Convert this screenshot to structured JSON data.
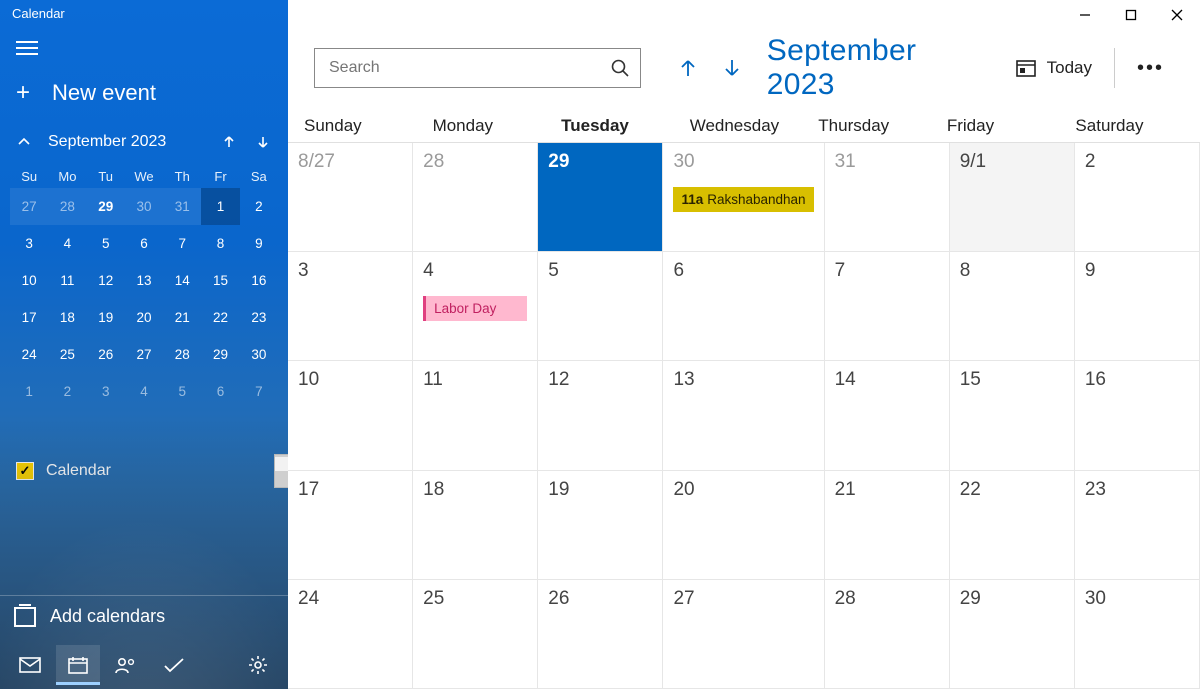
{
  "window": {
    "title": "Calendar"
  },
  "sidebar": {
    "new_event_label": "New event",
    "mini": {
      "title": "September 2023",
      "dow": [
        "Su",
        "Mo",
        "Tu",
        "We",
        "Th",
        "Fr",
        "Sa"
      ],
      "rows": [
        [
          {
            "d": "27",
            "other": true,
            "rng": true
          },
          {
            "d": "28",
            "other": true,
            "rng": true
          },
          {
            "d": "29",
            "sel": true,
            "rng": true
          },
          {
            "d": "30",
            "other": true,
            "rng": true
          },
          {
            "d": "31",
            "other": true,
            "rng": true
          },
          {
            "d": "1",
            "fri1": true
          },
          {
            "d": "2"
          }
        ],
        [
          {
            "d": "3"
          },
          {
            "d": "4"
          },
          {
            "d": "5"
          },
          {
            "d": "6"
          },
          {
            "d": "7"
          },
          {
            "d": "8"
          },
          {
            "d": "9"
          }
        ],
        [
          {
            "d": "10"
          },
          {
            "d": "11"
          },
          {
            "d": "12"
          },
          {
            "d": "13"
          },
          {
            "d": "14"
          },
          {
            "d": "15"
          },
          {
            "d": "16"
          }
        ],
        [
          {
            "d": "17"
          },
          {
            "d": "18"
          },
          {
            "d": "19"
          },
          {
            "d": "20"
          },
          {
            "d": "21"
          },
          {
            "d": "22"
          },
          {
            "d": "23"
          }
        ],
        [
          {
            "d": "24"
          },
          {
            "d": "25"
          },
          {
            "d": "26"
          },
          {
            "d": "27"
          },
          {
            "d": "28"
          },
          {
            "d": "29"
          },
          {
            "d": "30"
          }
        ],
        [
          {
            "d": "1",
            "other": true
          },
          {
            "d": "2",
            "other": true
          },
          {
            "d": "3",
            "other": true
          },
          {
            "d": "4",
            "other": true
          },
          {
            "d": "5",
            "other": true
          },
          {
            "d": "6",
            "other": true
          },
          {
            "d": "7",
            "other": true
          }
        ]
      ]
    },
    "calendar_item_label": "Calendar",
    "add_calendars_label": "Add calendars"
  },
  "topbar": {
    "search_placeholder": "Search",
    "month_label": "September 2023",
    "today_label": "Today"
  },
  "dow": [
    "Sunday",
    "Monday",
    "Tuesday",
    "Wednesday",
    "Thursday",
    "Friday",
    "Saturday"
  ],
  "dow_selected_index": 2,
  "grid": [
    [
      {
        "num": "8/27",
        "other": true
      },
      {
        "num": "28",
        "other": true
      },
      {
        "num": "29",
        "today": true
      },
      {
        "num": "30",
        "other": true,
        "event": {
          "kind": "yellow",
          "time": "11a",
          "title": "Rakshabandhan"
        }
      },
      {
        "num": "31",
        "other": true
      },
      {
        "num": "9/1",
        "nextstart": true
      },
      {
        "num": "2"
      }
    ],
    [
      {
        "num": "3"
      },
      {
        "num": "4",
        "event": {
          "kind": "pink",
          "title": "Labor Day"
        }
      },
      {
        "num": "5"
      },
      {
        "num": "6"
      },
      {
        "num": "7"
      },
      {
        "num": "8"
      },
      {
        "num": "9"
      }
    ],
    [
      {
        "num": "10"
      },
      {
        "num": "11"
      },
      {
        "num": "12"
      },
      {
        "num": "13"
      },
      {
        "num": "14"
      },
      {
        "num": "15"
      },
      {
        "num": "16"
      }
    ],
    [
      {
        "num": "17"
      },
      {
        "num": "18"
      },
      {
        "num": "19"
      },
      {
        "num": "20"
      },
      {
        "num": "21"
      },
      {
        "num": "22"
      },
      {
        "num": "23"
      }
    ],
    [
      {
        "num": "24"
      },
      {
        "num": "25"
      },
      {
        "num": "26"
      },
      {
        "num": "27"
      },
      {
        "num": "28"
      },
      {
        "num": "29"
      },
      {
        "num": "30"
      }
    ]
  ]
}
